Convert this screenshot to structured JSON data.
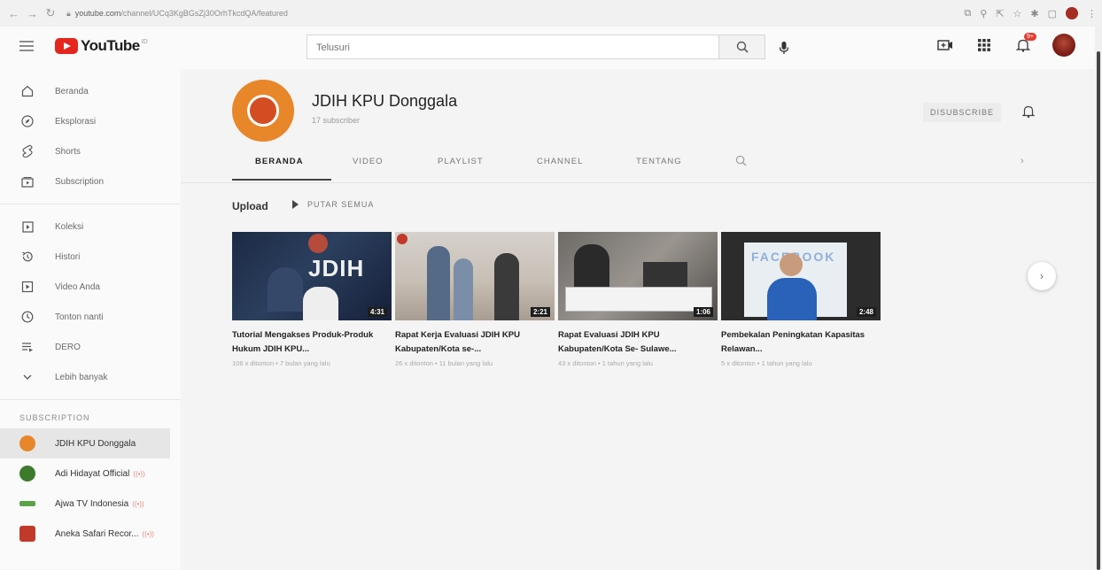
{
  "browser": {
    "url_host": "youtube.com",
    "url_path": "/channel/UCq3KgBGsZj30OrhTkcdQA/featured"
  },
  "masthead": {
    "logo_text": "YouTube",
    "logo_superscript": "ID",
    "search_placeholder": "Telusuri",
    "notification_count": "9+"
  },
  "sidebar": {
    "primary": [
      {
        "label": "Beranda",
        "icon": "home-icon"
      },
      {
        "label": "Eksplorasi",
        "icon": "compass-icon"
      },
      {
        "label": "Shorts",
        "icon": "shorts-icon"
      },
      {
        "label": "Subscription",
        "icon": "subscriptions-icon"
      }
    ],
    "library": [
      {
        "label": "Koleksi",
        "icon": "library-icon"
      },
      {
        "label": "Histori",
        "icon": "history-icon"
      },
      {
        "label": "Video Anda",
        "icon": "your-videos-icon"
      },
      {
        "label": "Tonton nanti",
        "icon": "watch-later-icon"
      },
      {
        "label": "DERO",
        "icon": "playlist-icon"
      },
      {
        "label": "Lebih banyak",
        "icon": "chevron-down-icon"
      }
    ],
    "subscription_heading": "SUBSCRIPTION",
    "subscriptions": [
      {
        "label": "JDIH KPU Donggala",
        "color": "#e8862a",
        "live": ""
      },
      {
        "label": "Adi Hidayat Official",
        "color": "#3d7a2c",
        "live": "((•))"
      },
      {
        "label": "Ajwa TV Indonesia",
        "color": "#5aa34a",
        "live": "((•))"
      },
      {
        "label": "Aneka Safari Recor...",
        "color": "#c0392b",
        "live": "((•))"
      }
    ]
  },
  "channel": {
    "name": "JDIH KPU Donggala",
    "subscribers": "17 subscriber",
    "unsubscribe_label": "DISUBSCRIBE",
    "tabs": [
      "BERANDA",
      "VIDEO",
      "PLAYLIST",
      "CHANNEL",
      "TENTANG"
    ],
    "active_tab": "BERANDA"
  },
  "uploads": {
    "heading": "Upload",
    "play_all": "PUTAR SEMUA",
    "videos": [
      {
        "title": "Tutorial Mengakses Produk-Produk Hukum JDIH KPU...",
        "meta": "106 x ditonton • 7 bulan yang lalu",
        "duration": "4:31"
      },
      {
        "title": "Rapat Kerja Evaluasi JDIH KPU Kabupaten/Kota se-...",
        "meta": "26 x ditonton • 11 bulan yang lalu",
        "duration": "2:21"
      },
      {
        "title": "Rapat Evaluasi JDIH KPU Kabupaten/Kota Se- Sulawe...",
        "meta": "43 x ditonton • 1 tahun yang lalu",
        "duration": "1:06"
      },
      {
        "title": "Pembekalan Peningkatan Kapasitas Relawan...",
        "meta": "5 x ditonton • 1 tahun yang lalu",
        "duration": "2:48"
      }
    ]
  },
  "colors": {
    "accent": "#e5261f",
    "channel_orange": "#e8862a"
  }
}
